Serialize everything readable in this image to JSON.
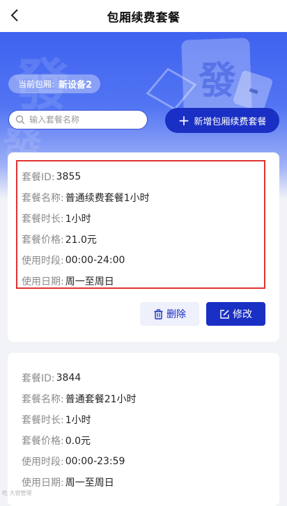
{
  "header": {
    "title": "包厢续费套餐"
  },
  "device": {
    "label": "当前包厢:",
    "name": "新设备2"
  },
  "search": {
    "placeholder": "输入套餐名称"
  },
  "add_button": {
    "label": "新增包厢续费套餐"
  },
  "packages": [
    {
      "fields": [
        {
          "label": "套餐ID:",
          "value": "3855"
        },
        {
          "label": "套餐名称:",
          "value": "普通续费套餐1小时"
        },
        {
          "label": "套餐时长:",
          "value": "1小时"
        },
        {
          "label": "套餐价格:",
          "value": "21.0元"
        },
        {
          "label": "使用时段:",
          "value": "00:00-24:00"
        },
        {
          "label": "使用日期:",
          "value": "周一至周日"
        }
      ],
      "delete_label": "删除",
      "edit_label": "修改"
    },
    {
      "fields": [
        {
          "label": "套餐ID:",
          "value": "3844"
        },
        {
          "label": "套餐名称:",
          "value": "普通套餐21小时"
        },
        {
          "label": "套餐时长:",
          "value": "1小时"
        },
        {
          "label": "套餐价格:",
          "value": "0.0元"
        },
        {
          "label": "使用时段:",
          "value": "00:00-23:59"
        },
        {
          "label": "使用日期:",
          "value": "周一至周日"
        }
      ]
    }
  ],
  "hero_glyph": "發",
  "watermark": "吃 大宿管理",
  "colors": {
    "primary": "#1a2fc4",
    "highlight": "#e03131",
    "hero": "#3f62f0"
  }
}
